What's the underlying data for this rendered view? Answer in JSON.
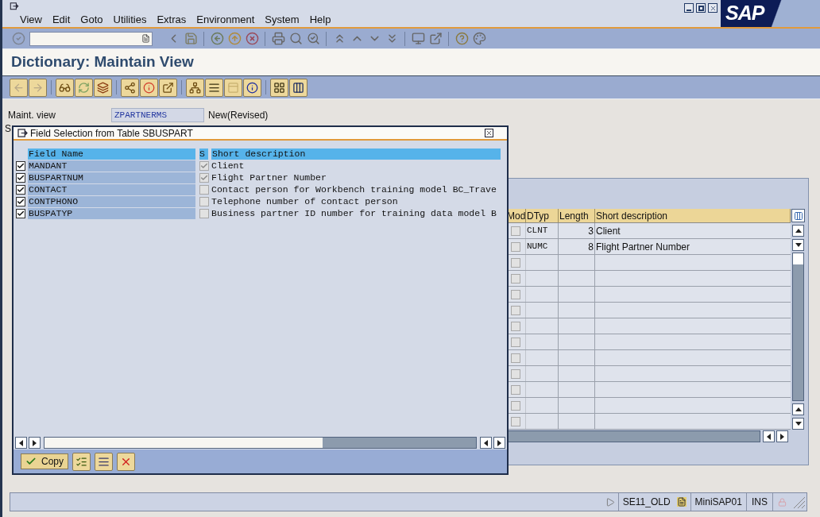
{
  "menu_bar": {
    "items": [
      "View",
      "Edit",
      "Goto",
      "Utilities",
      "Extras",
      "Environment",
      "System",
      "Help"
    ],
    "logo": "SAP"
  },
  "title": "Dictionary: Maintain View",
  "maint_view": {
    "label": "Maint. view",
    "value": "ZPARTNERMS",
    "status": "New(Revised)",
    "next_label_fragment": "S"
  },
  "view_fields_table": {
    "columns": [
      "Mod",
      "DTyp",
      "Length",
      "Short description"
    ],
    "rows": [
      {
        "checked": false,
        "dtyp": "CLNT",
        "length": "3",
        "description": "Client"
      },
      {
        "checked": false,
        "dtyp": "NUMC",
        "length": "8",
        "description": "Flight Partner Number"
      },
      {
        "checked": false
      },
      {
        "checked": false
      },
      {
        "checked": false
      },
      {
        "checked": false
      },
      {
        "checked": false
      },
      {
        "checked": false
      },
      {
        "checked": false
      },
      {
        "checked": false
      },
      {
        "checked": false
      },
      {
        "checked": false
      },
      {
        "checked": false
      }
    ]
  },
  "popup": {
    "title": "Field Selection from Table SBUSPART",
    "columns": [
      "Field Name",
      "S",
      "Short description"
    ],
    "rows": [
      {
        "selected": true,
        "field": "MANDANT",
        "key": true,
        "description": "Client"
      },
      {
        "selected": true,
        "field": "BUSPARTNUM",
        "key": true,
        "description": "Flight Partner Number"
      },
      {
        "selected": true,
        "field": "CONTACT",
        "key": false,
        "description": "Contact person for Workbench training model BC_Trave"
      },
      {
        "selected": true,
        "field": "CONTPHONO",
        "key": false,
        "description": "Telephone number of contact person"
      },
      {
        "selected": true,
        "field": "BUSPATYP",
        "key": false,
        "description": "Business partner ID number for training data model B"
      }
    ],
    "copy_button": "Copy"
  },
  "status_bar": {
    "transaction": "SE11_OLD",
    "system": "MiniSAP01",
    "mode": "INS"
  }
}
